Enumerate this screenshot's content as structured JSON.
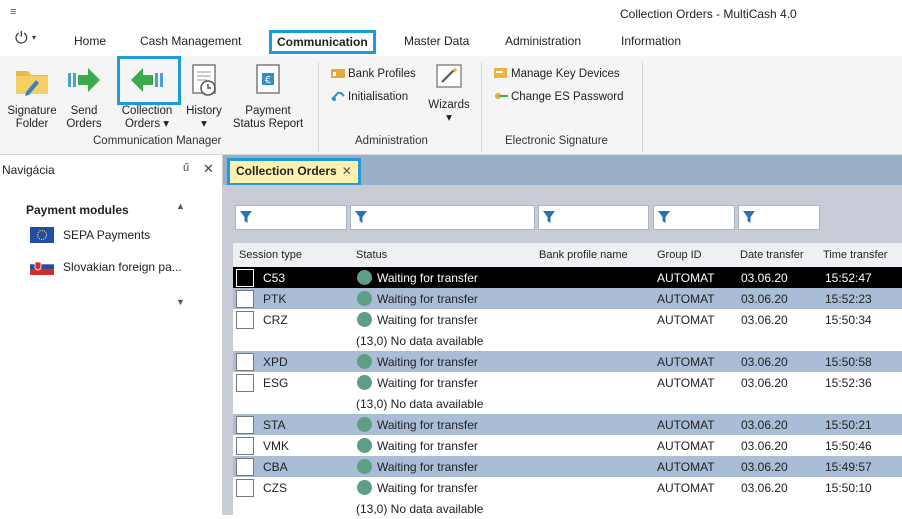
{
  "window": {
    "title": "Collection Orders - MultiCash 4.0",
    "quick_access": "≡"
  },
  "ribbon_tabs": [
    "Home",
    "Cash Management",
    "Communication",
    "Master Data",
    "Administration",
    "Information"
  ],
  "ribbon": {
    "signature_folder": [
      "Signature",
      "Folder"
    ],
    "send_orders": [
      "Send",
      "Orders"
    ],
    "collection_orders": [
      "Collection",
      "Orders ▾"
    ],
    "history": [
      "History",
      "▾"
    ],
    "payment_status_report": [
      "Payment",
      "Status Report"
    ],
    "group_communication_manager": "Communication Manager",
    "bank_profiles": "Bank Profiles",
    "initialisation": "Initialisation",
    "wizards": "Wizards",
    "wizards_caret": "▾",
    "group_administration": "Administration",
    "manage_key_devices": "Manage Key Devices",
    "change_es_password": "Change ES Password",
    "group_electronic_signature": "Electronic Signature"
  },
  "nav": {
    "title": "Navigácia",
    "pin": "ű",
    "close": "✕",
    "section": "Payment modules",
    "items": [
      "SEPA Payments",
      "Slovakian foreign pa..."
    ]
  },
  "document_tab": {
    "label": "Collection Orders",
    "close": "✕"
  },
  "table": {
    "columns": [
      "Session type",
      "Status",
      "Bank profile name",
      "Group ID",
      "Date transfer",
      "Time transfer"
    ],
    "rows": [
      {
        "session": "C53",
        "status": "Waiting for transfer",
        "group": "AUTOMAT",
        "date": "03.06.20",
        "time": "15:52:47",
        "note": ""
      },
      {
        "session": "PTK",
        "status": "Waiting for transfer",
        "group": "AUTOMAT",
        "date": "03.06.20",
        "time": "15:52:23",
        "note": ""
      },
      {
        "session": "CRZ",
        "status": "Waiting for transfer",
        "group": "AUTOMAT",
        "date": "03.06.20",
        "time": "15:50:34",
        "note": "(13,0) No data available"
      },
      {
        "session": "XPD",
        "status": "Waiting for transfer",
        "group": "AUTOMAT",
        "date": "03.06.20",
        "time": "15:50:58",
        "note": ""
      },
      {
        "session": "ESG",
        "status": "Waiting for transfer",
        "group": "AUTOMAT",
        "date": "03.06.20",
        "time": "15:52:36",
        "note": "(13,0) No data available"
      },
      {
        "session": "STA",
        "status": "Waiting for transfer",
        "group": "AUTOMAT",
        "date": "03.06.20",
        "time": "15:50:21",
        "note": ""
      },
      {
        "session": "VMK",
        "status": "Waiting for transfer",
        "group": "AUTOMAT",
        "date": "03.06.20",
        "time": "15:50:46",
        "note": ""
      },
      {
        "session": "CBA",
        "status": "Waiting for transfer",
        "group": "AUTOMAT",
        "date": "03.06.20",
        "time": "15:49:57",
        "note": ""
      },
      {
        "session": "CZS",
        "status": "Waiting for transfer",
        "group": "AUTOMAT",
        "date": "03.06.20",
        "time": "15:50:10",
        "note": "(13,0) No data available"
      }
    ]
  },
  "colors": {
    "accent": "#1f9bd7",
    "row_alt": "#a9bed6",
    "status_dot": "#5f9e86",
    "doc_tab": "#fff2b0"
  }
}
